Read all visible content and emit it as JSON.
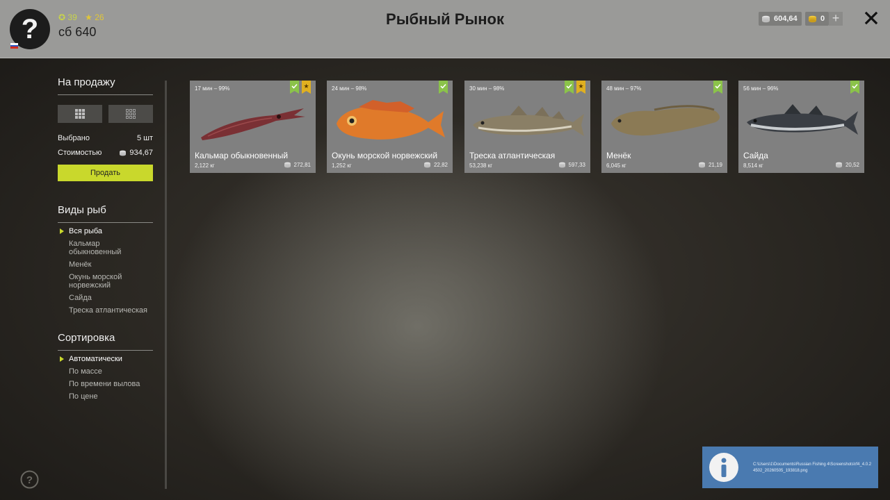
{
  "player": {
    "level": "39",
    "stars": "26",
    "name": "сб 640",
    "avatar_glyph": "?"
  },
  "header": {
    "title": "Рыбный Рынок",
    "silver": "604,64",
    "gold": "0",
    "plus_glyph": "+"
  },
  "sidebar": {
    "sale_title": "На продажу",
    "selected_label": "Выбрано",
    "selected_value": "5 шт",
    "cost_label": "Стоимостью",
    "cost_value": "934,67",
    "sell_button": "Продать",
    "species_title": "Виды рыб",
    "species": [
      "Вся рыба",
      "Кальмар обыкновенный",
      "Менёк",
      "Окунь морской норвежский",
      "Сайда",
      "Треска атлантическая"
    ],
    "species_active_index": 0,
    "sort_title": "Сортировка",
    "sort_options": [
      "Автоматически",
      "По массе",
      "По времени вылова",
      "По цене"
    ],
    "sort_active_index": 0
  },
  "fish": [
    {
      "meta": "17 мин – 99%",
      "name": "Кальмар обыкновенный",
      "weight": "2,122 кг",
      "price": "272,81",
      "starred": true,
      "icon": "squid"
    },
    {
      "meta": "24 мин – 98%",
      "name": "Окунь морской норвежский",
      "weight": "1,252 кг",
      "price": "22,82",
      "starred": false,
      "icon": "redfish"
    },
    {
      "meta": "30 мин – 98%",
      "name": "Треска атлантическая",
      "weight": "53,238 кг",
      "price": "597,33",
      "starred": true,
      "icon": "cod"
    },
    {
      "meta": "48 мин – 97%",
      "name": "Менёк",
      "weight": "6,045 кг",
      "price": "21,19",
      "starred": false,
      "icon": "tusk"
    },
    {
      "meta": "56 мин – 96%",
      "name": "Сайда",
      "weight": "8,514 кг",
      "price": "20,52",
      "starred": false,
      "icon": "saithe"
    }
  ],
  "notification": {
    "path": "C:\\Users\\1\\Documents\\Russian Fishing 4\\Screenshots\\rf4_4.0.24502_20260505_193818.png"
  },
  "colors": {
    "accent": "#c9d82c",
    "badge_green": "#8bc34a",
    "badge_gold": "#e0b020",
    "card_bg": "#808080",
    "topbar_bg": "#9a9a98",
    "toast_bg": "#4a7ab0"
  }
}
